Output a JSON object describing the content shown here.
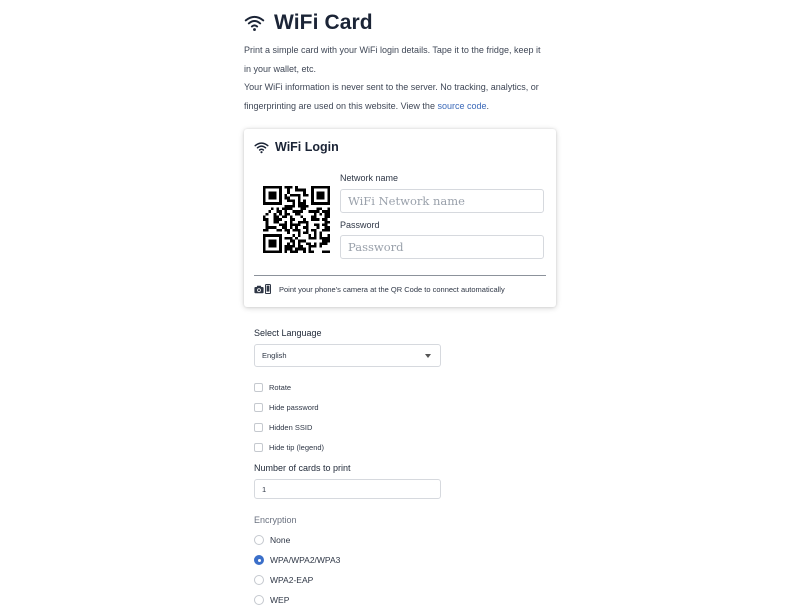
{
  "header": {
    "title": "WiFi Card"
  },
  "intro": {
    "line1": "Print a simple card with your WiFi login details. Tape it to the fridge, keep it in your wallet, etc.",
    "line2_prefix": "Your WiFi information is never sent to the server. No tracking, analytics, or fingerprinting are used on this website. View the ",
    "link_text": "source code",
    "line2_suffix": "."
  },
  "card": {
    "title": "WiFi Login",
    "ssid_label": "Network name",
    "ssid_placeholder": "WiFi Network name",
    "ssid_value": "",
    "password_label": "Password",
    "password_placeholder": "Password",
    "password_value": "",
    "legend": "Point your phone's camera at the QR Code to connect automatically"
  },
  "settings": {
    "language_label": "Select Language",
    "language_value": "English",
    "options": [
      {
        "label": "Rotate",
        "checked": false
      },
      {
        "label": "Hide password",
        "checked": false
      },
      {
        "label": "Hidden SSID",
        "checked": false
      },
      {
        "label": "Hide tip (legend)",
        "checked": false
      }
    ],
    "count_label": "Number of cards to print",
    "count_value": "1",
    "encryption_label": "Encryption",
    "encryption_options": [
      {
        "label": "None",
        "selected": false
      },
      {
        "label": "WPA/WPA2/WPA3",
        "selected": true
      },
      {
        "label": "WPA2-EAP",
        "selected": false
      },
      {
        "label": "WEP",
        "selected": false
      }
    ]
  },
  "icons": {
    "header": "wifi-icon",
    "card": "wifi-icon",
    "legend": [
      "camera-icon",
      "phone-icon"
    ]
  },
  "colors": {
    "accent": "#3b6fc9",
    "link": "#3a68b8",
    "heading": "#1b2436"
  }
}
